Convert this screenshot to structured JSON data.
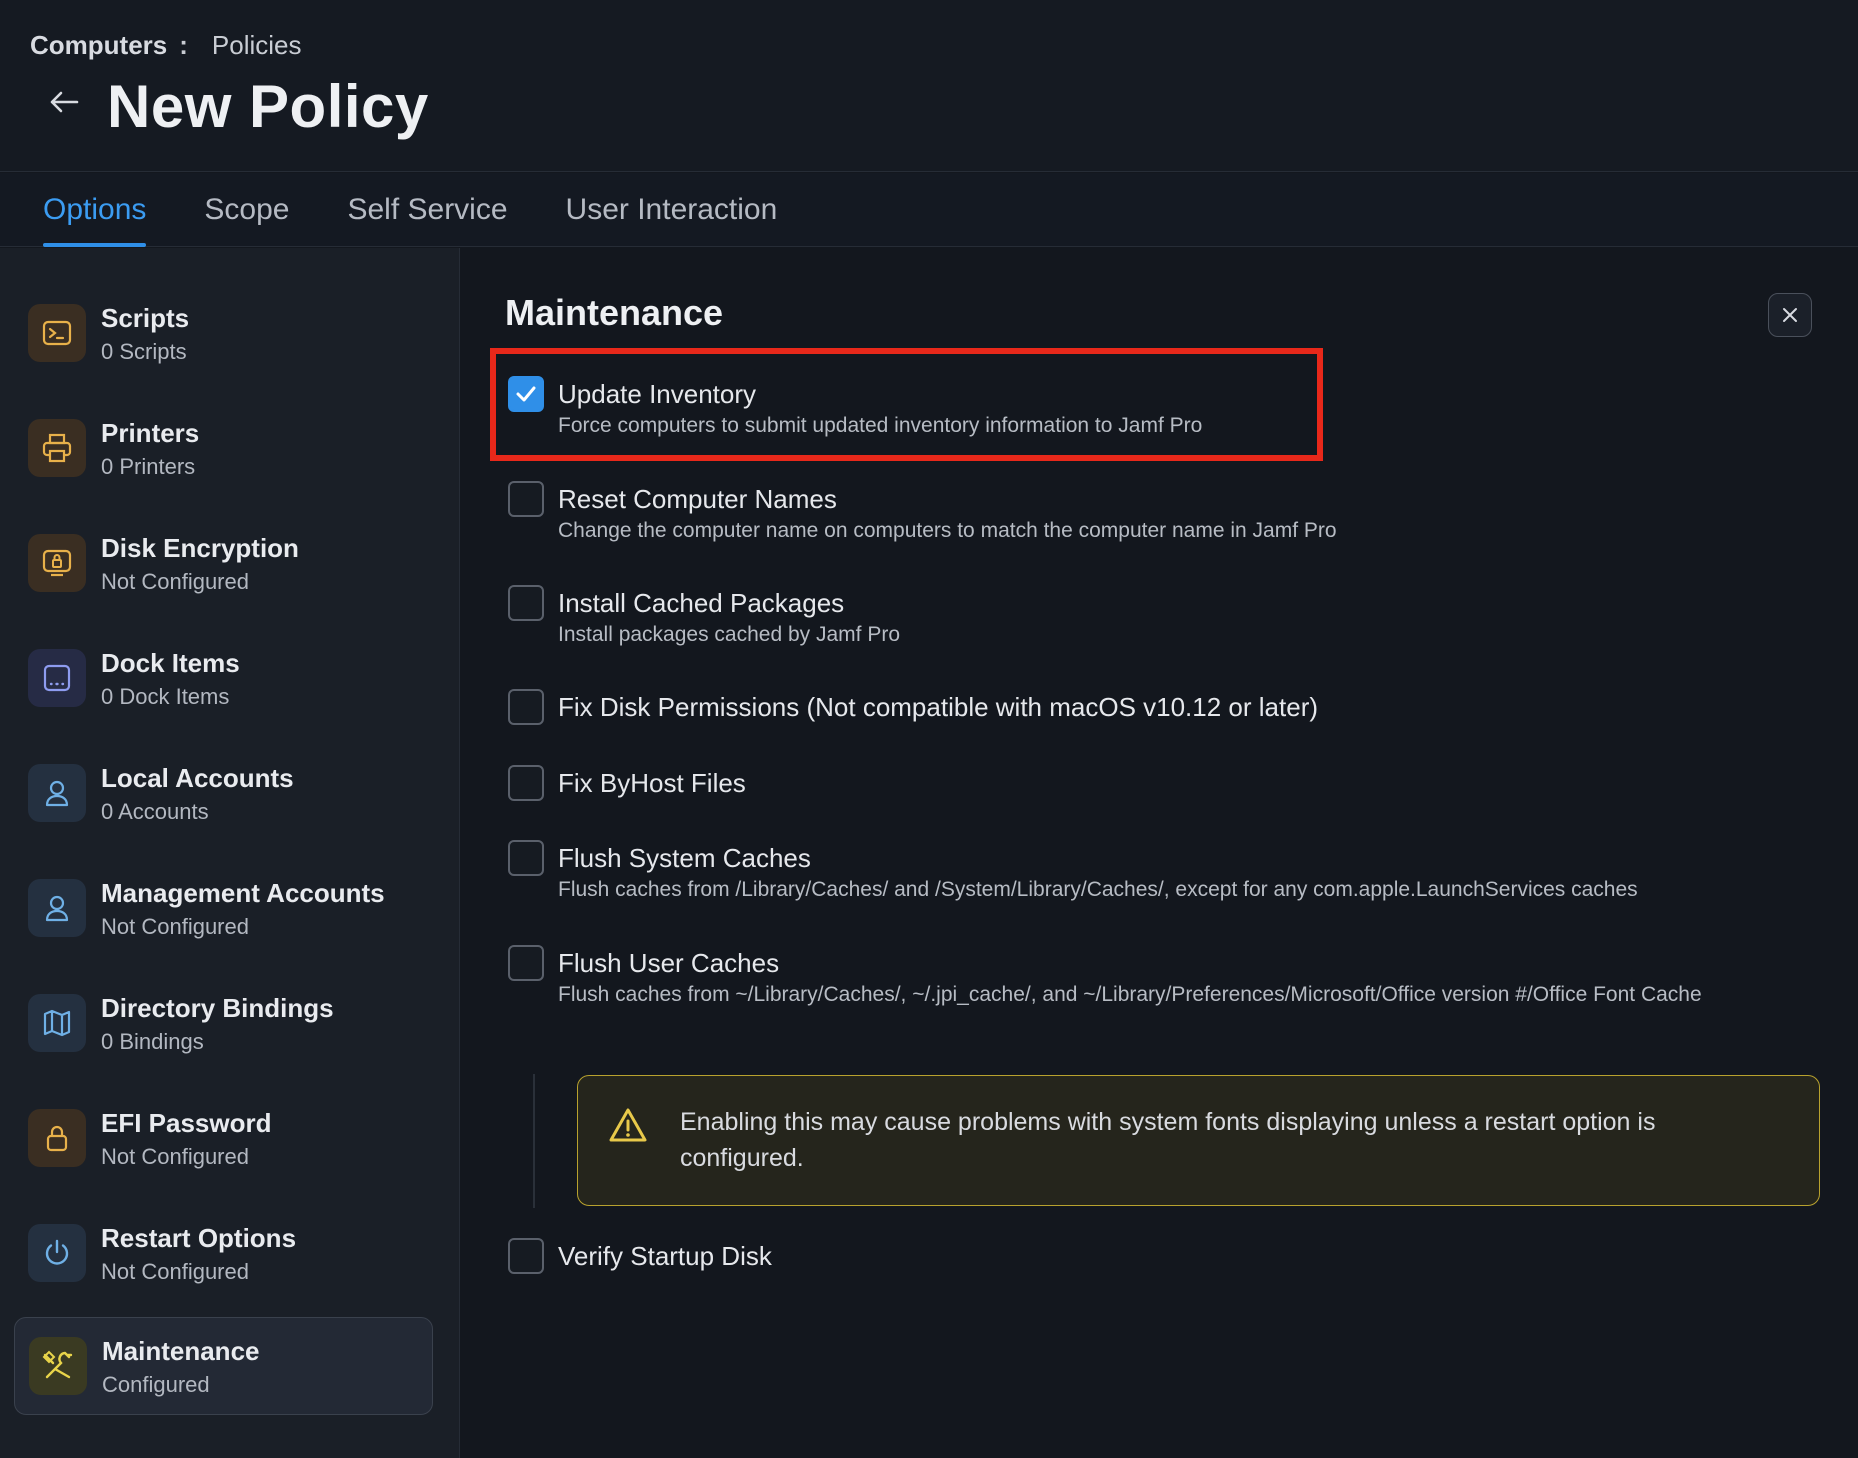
{
  "breadcrumb": {
    "parent": "Computers",
    "separator": ":",
    "current": "Policies"
  },
  "page_title": "New Policy",
  "tabs": [
    {
      "label": "Options",
      "active": true
    },
    {
      "label": "Scope",
      "active": false
    },
    {
      "label": "Self Service",
      "active": false
    },
    {
      "label": "User Interaction",
      "active": false
    }
  ],
  "sidebar": {
    "items": [
      {
        "title": "Scripts",
        "subtitle": "0 Scripts",
        "icon": "terminal-icon"
      },
      {
        "title": "Printers",
        "subtitle": "0 Printers",
        "icon": "printer-icon"
      },
      {
        "title": "Disk Encryption",
        "subtitle": "Not Configured",
        "icon": "disk-lock-icon"
      },
      {
        "title": "Dock Items",
        "subtitle": "0 Dock Items",
        "icon": "dock-icon"
      },
      {
        "title": "Local Accounts",
        "subtitle": "0 Accounts",
        "icon": "user-icon"
      },
      {
        "title": "Management Accounts",
        "subtitle": "Not Configured",
        "icon": "user-icon"
      },
      {
        "title": "Directory Bindings",
        "subtitle": "0 Bindings",
        "icon": "map-icon"
      },
      {
        "title": "EFI Password",
        "subtitle": "Not Configured",
        "icon": "lock-icon"
      },
      {
        "title": "Restart Options",
        "subtitle": "Not Configured",
        "icon": "power-icon"
      },
      {
        "title": "Maintenance",
        "subtitle": "Configured",
        "icon": "tools-icon",
        "active": true
      }
    ]
  },
  "main": {
    "section_title": "Maintenance",
    "options": [
      {
        "label": "Update Inventory",
        "description": "Force computers to submit updated inventory information to Jamf Pro",
        "checked": true
      },
      {
        "label": "Reset Computer Names",
        "description": "Change the computer name on computers to match the computer name in Jamf Pro",
        "checked": false
      },
      {
        "label": "Install Cached Packages",
        "description": "Install packages cached by Jamf Pro",
        "checked": false
      },
      {
        "label": "Fix Disk Permissions (Not compatible with macOS v10.12 or later)",
        "description": "",
        "checked": false
      },
      {
        "label": "Fix ByHost Files",
        "description": "",
        "checked": false
      },
      {
        "label": "Flush System Caches",
        "description": "Flush caches from /Library/Caches/ and /System/Library/Caches/, except for any com.apple.LaunchServices caches",
        "checked": false
      },
      {
        "label": "Flush User Caches",
        "description": "Flush caches from ~/Library/Caches/, ~/.jpi_cache/, and ~/Library/Preferences/Microsoft/Office version #/Office Font Cache",
        "checked": false
      },
      {
        "label": "Verify Startup Disk",
        "description": "",
        "checked": false
      }
    ],
    "warning": "Enabling this may cause problems with system fonts displaying unless a restart option is configured."
  },
  "colors": {
    "accent": "#2f8fe8",
    "highlight": "#e8281a",
    "warning_border": "#b8a22e",
    "icon_amber": "#e8b14a",
    "icon_blue": "#6fb0e6"
  }
}
